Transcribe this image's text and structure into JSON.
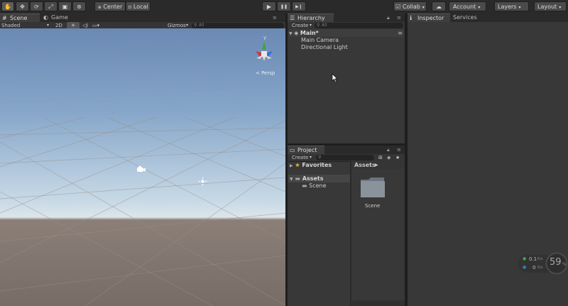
{
  "toolbar": {
    "tools": [
      {
        "name": "hand-tool-icon",
        "glyph": "✋"
      },
      {
        "name": "move-tool-icon",
        "glyph": "✥"
      },
      {
        "name": "rotate-tool-icon",
        "glyph": "⟳"
      },
      {
        "name": "scale-tool-icon",
        "glyph": "⤢"
      },
      {
        "name": "rect-tool-icon",
        "glyph": "▣"
      },
      {
        "name": "transform-tool-icon",
        "glyph": "⊛"
      }
    ],
    "pivot_label": "Center",
    "space_label": "Local",
    "play_glyph": "▶",
    "pause_glyph": "❚❚",
    "step_glyph": "▶❙",
    "collab_label": "Collab",
    "account_label": "Account",
    "layers_label": "Layers",
    "layout_label": "Layout"
  },
  "scene_panel": {
    "tabs": [
      {
        "label": "Scene",
        "icon": "#"
      },
      {
        "label": "Game",
        "icon": "◐"
      }
    ],
    "shading_mode": "Shaded",
    "mode_2d": "2D",
    "gizmos_label": "Gizmos",
    "search_placeholder": "All",
    "persp_label": "< Persp",
    "gizmo_axis_y": "y"
  },
  "hierarchy": {
    "tab_label": "Hierarchy",
    "create_label": "Create",
    "search_placeholder": "All",
    "scene_name": "Main*",
    "items": [
      "Main Camera",
      "Directional Light"
    ]
  },
  "project": {
    "tab_label": "Project",
    "create_label": "Create",
    "favorites_label": "Favorites",
    "assets_label": "Assets",
    "tree_items": [
      "Scene"
    ],
    "breadcrumb": "Assets",
    "grid_items": [
      {
        "label": "Scene"
      }
    ]
  },
  "inspector": {
    "tabs": [
      {
        "label": "Inspector",
        "icon": "ℹ"
      },
      {
        "label": "Services"
      }
    ]
  },
  "perf_overlay": {
    "upload": "0.1",
    "upload_unit": "K/s",
    "download": "0",
    "download_unit": "K/s",
    "value": "59",
    "unit": "%"
  },
  "colors": {
    "accent_green": "#3da543",
    "gizmo_red": "#d4333a",
    "gizmo_blue": "#3370d8"
  }
}
